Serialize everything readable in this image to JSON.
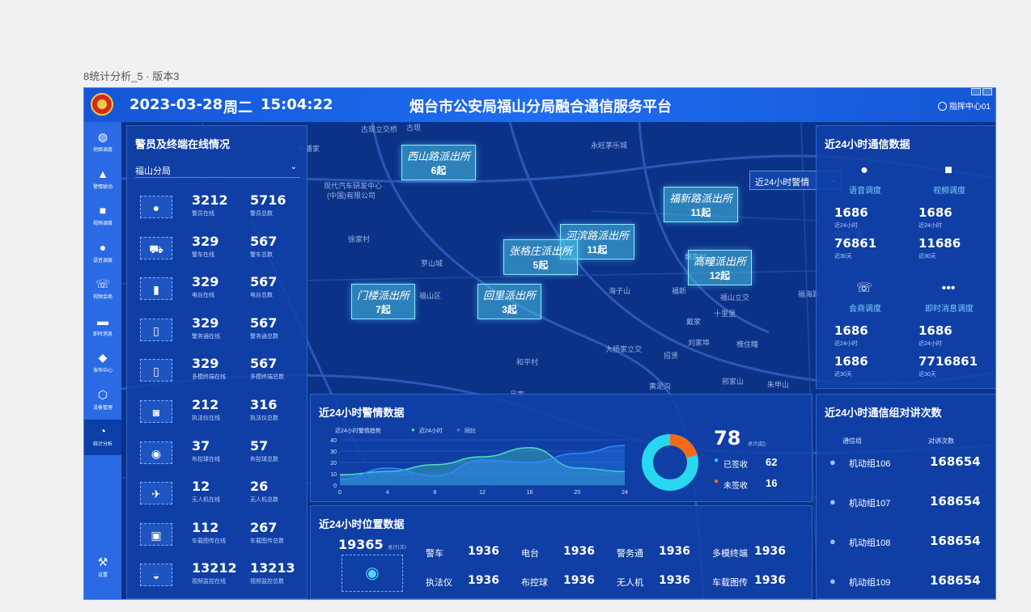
{
  "caption": "8统计分析_5 · 版本3",
  "header": {
    "date": "2023-03-28",
    "weekday": "周二",
    "time": "15:04:22",
    "title": "烟台市公安局福山分局融合通信服务平台",
    "user": "指挥中心01"
  },
  "nav": [
    {
      "label": "地图调度",
      "icon": "globe-icon",
      "glyph": "◍"
    },
    {
      "label": "警情联动",
      "icon": "siren-icon",
      "glyph": "▲"
    },
    {
      "label": "视频调度",
      "icon": "video-icon",
      "glyph": "■"
    },
    {
      "label": "语音调度",
      "icon": "microphone-icon",
      "glyph": "●"
    },
    {
      "label": "视频会商",
      "icon": "phone-icon",
      "glyph": "☏"
    },
    {
      "label": "即时消息",
      "icon": "message-icon",
      "glyph": "▬"
    },
    {
      "label": "发布中心",
      "icon": "bell-icon",
      "glyph": "◆"
    },
    {
      "label": "设备管理",
      "icon": "box-icon",
      "glyph": "⬡"
    },
    {
      "label": "统计分析",
      "icon": "pie-chart-icon",
      "glyph": "◔"
    }
  ],
  "nav_settings": {
    "label": "设置",
    "icon": "wrench-icon",
    "glyph": "⚒"
  },
  "left_panel": {
    "title": "警员及终端在线情况",
    "dropdown": "福山分局",
    "rows": [
      {
        "icon": "officer-icon",
        "glyph": "●",
        "v1": "3212",
        "l1": "警员在线",
        "v2": "5716",
        "l2": "警员总数"
      },
      {
        "icon": "police-car-icon",
        "glyph": "⛟",
        "v1": "329",
        "l1": "警车在线",
        "v2": "567",
        "l2": "警车总数"
      },
      {
        "icon": "radio-icon",
        "glyph": "▮",
        "v1": "329",
        "l1": "电台在线",
        "v2": "567",
        "l2": "电台总数"
      },
      {
        "icon": "tablet-icon",
        "glyph": "▯",
        "v1": "329",
        "l1": "警务通在线",
        "v2": "567",
        "l2": "警务通总数"
      },
      {
        "icon": "multimode-terminal-icon",
        "glyph": "▯",
        "v1": "329",
        "l1": "多模终端在线",
        "v2": "567",
        "l2": "多模终端总数"
      },
      {
        "icon": "body-camera-icon",
        "glyph": "◙",
        "v1": "212",
        "l1": "执法仪在线",
        "v2": "316",
        "l2": "执法仪总数"
      },
      {
        "icon": "dome-camera-icon",
        "glyph": "◉",
        "v1": "37",
        "l1": "布控球在线",
        "v2": "57",
        "l2": "布控球总数"
      },
      {
        "icon": "drone-icon",
        "glyph": "✈",
        "v1": "12",
        "l1": "无人机在线",
        "v2": "26",
        "l2": "无人机总数"
      },
      {
        "icon": "vehicle-camera-icon",
        "glyph": "▣",
        "v1": "112",
        "l1": "车载图传在线",
        "v2": "267",
        "l2": "车载图传总数"
      },
      {
        "icon": "surveillance-icon",
        "glyph": "◒",
        "v1": "13212",
        "l1": "视频监控在线",
        "v2": "13213",
        "l2": "视频监控总数"
      }
    ]
  },
  "map": {
    "filter": "近24小时警情",
    "markers": [
      {
        "name": "西山路派出所",
        "count": "6起"
      },
      {
        "name": "福新路派出所",
        "count": "11起"
      },
      {
        "name": "河滨路派出所",
        "count": "11起"
      },
      {
        "name": "张格庄派出所",
        "count": "5起"
      },
      {
        "name": "高疃派出所",
        "count": "12起"
      },
      {
        "name": "门楼派出所",
        "count": "7起"
      },
      {
        "name": "回里派出所",
        "count": "3起"
      }
    ],
    "labels": [
      "古现立交桥",
      "古现",
      "永旺茅乐城",
      "小潘家",
      "现代汽车研发中心",
      "(中国)有限公司",
      "徐家村",
      "罗山城",
      "福山区",
      "万达广场",
      "魏家村",
      "海子山",
      "福新",
      "福山立交",
      "十里堡",
      "福海路",
      "刘家埠",
      "槐住疃",
      "和平村",
      "大杨家立交",
      "招贤",
      "邢家山",
      "朱甲山",
      "黄泥沟",
      "吕家",
      "戴家"
    ]
  },
  "alerts": {
    "title": "近24小时警情数据",
    "chart_title": "近24小时警情趋势",
    "legend": [
      "近24小时",
      "同比"
    ],
    "total": "78",
    "total_unit": "总计(起)",
    "signed_label": "已签收",
    "signed": "62",
    "unsigned_label": "未签收",
    "unsigned": "16",
    "colors": {
      "series1": "#4de0c0",
      "series2": "#2f8cff",
      "signed": "#27d8f0",
      "unsigned": "#f56a1a"
    }
  },
  "chart_data": {
    "type": "area",
    "title": "近24小时警情趋势",
    "x": [
      0,
      4,
      8,
      12,
      16,
      20,
      24
    ],
    "ylim": [
      0,
      40
    ],
    "yticks": [
      0,
      10,
      20,
      30,
      40
    ],
    "series": [
      {
        "name": "近24小时",
        "values": [
          9,
          12,
          18,
          25,
          33,
          15,
          12
        ]
      },
      {
        "name": "同比",
        "values": [
          5,
          15,
          8,
          22,
          20,
          28,
          35
        ]
      }
    ]
  },
  "location": {
    "title": "近24小时位置数据",
    "total": "19365",
    "total_unit": "总计(次)",
    "items": [
      {
        "label": "警车",
        "value": "1936"
      },
      {
        "label": "电台",
        "value": "1936"
      },
      {
        "label": "警务通",
        "value": "1936"
      },
      {
        "label": "多模终端",
        "value": "1936"
      },
      {
        "label": "执法仪",
        "value": "1936"
      },
      {
        "label": "布控球",
        "value": "1936"
      },
      {
        "label": "无人机",
        "value": "1936"
      },
      {
        "label": "车载图传",
        "value": "1936"
      }
    ]
  },
  "comm": {
    "title": "近24小时通信数据",
    "blocks": [
      {
        "label": "语音调度",
        "icon": "microphone-icon",
        "glyph": "●",
        "v24": "1686",
        "v30": "76861"
      },
      {
        "label": "视频调度",
        "icon": "video-icon",
        "glyph": "■",
        "v24": "1686",
        "v30": "11686"
      },
      {
        "label": "会商调度",
        "icon": "phone-icon",
        "glyph": "☏",
        "v24": "1686",
        "v30": "1686"
      },
      {
        "label": "即时消息调度",
        "icon": "message-icon",
        "glyph": "•••",
        "v24": "1686",
        "v30": "7716861"
      }
    ],
    "sub24": "近24小时",
    "sub30": "近30天"
  },
  "talk": {
    "title": "近24小时通信组对讲次数",
    "col1": "通信组",
    "col2": "对讲次数",
    "groups": [
      {
        "name": "机动组106",
        "value": "168654"
      },
      {
        "name": "机动组107",
        "value": "168654"
      },
      {
        "name": "机动组108",
        "value": "168654"
      },
      {
        "name": "机动组109",
        "value": "168654"
      }
    ]
  }
}
